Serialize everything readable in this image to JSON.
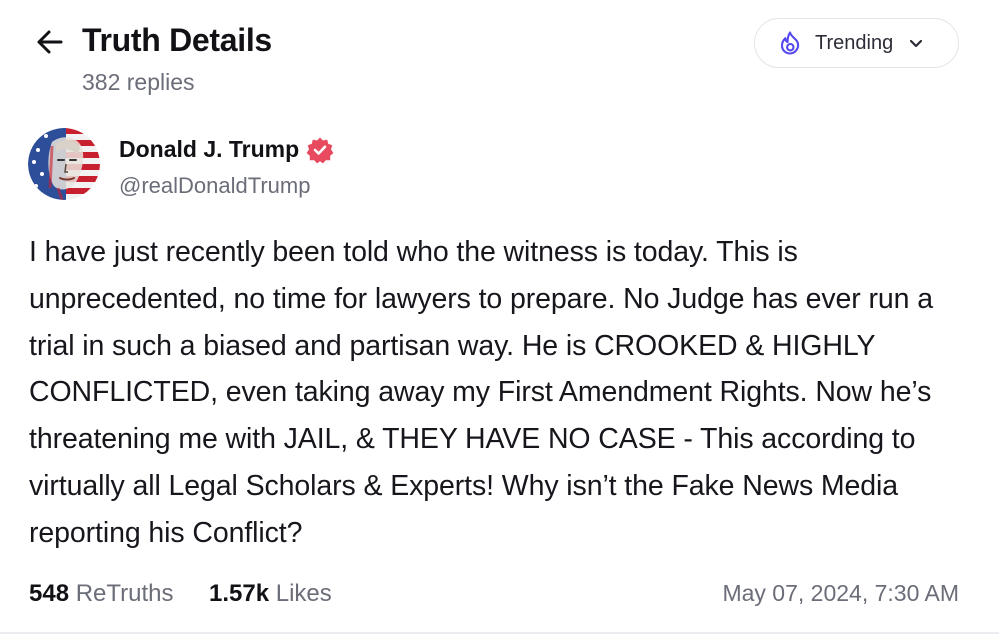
{
  "header": {
    "title": "Truth Details",
    "reply_count": "382 replies"
  },
  "sort": {
    "label": "Trending"
  },
  "icons": {
    "back": "arrow-left-icon",
    "trending": "flame-icon",
    "chevron": "chevron-down-icon",
    "verified": "verified-badge-icon"
  },
  "colors": {
    "accent": "#5448ee",
    "verified": "#e84a5f",
    "muted_text": "#6b6d78"
  },
  "post": {
    "author_name": "Donald J. Trump",
    "author_handle": "@realDonaldTrump",
    "text": "I have just recently been told who the witness is today. This is unprecedented, no time for lawyers to prepare. No Judge has ever run a trial in such a biased and partisan way. He is CROOKED & HIGHLY CONFLICTED, even taking away my First Amendment Rights. Now he’s threatening me with JAIL, & THEY HAVE NO CASE - This according to virtually all Legal Scholars & Experts! Why isn’t the Fake News Media reporting his Conflict?",
    "retruths_count": "548",
    "retruths_label": "ReTruths",
    "likes_count": "1.57k",
    "likes_label": "Likes",
    "timestamp": "May 07, 2024, 7:30 AM"
  }
}
